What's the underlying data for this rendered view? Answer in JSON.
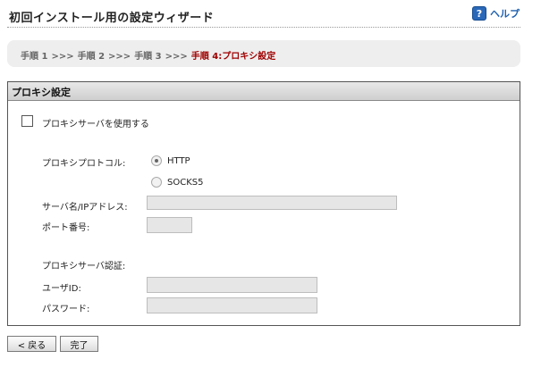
{
  "header": {
    "title": "初回インストール用の設定ウィザード",
    "help_label": "ヘルプ",
    "help_icon": "?"
  },
  "breadcrumb": {
    "steps": [
      "手順 1",
      "手順 2",
      "手順 3"
    ],
    "separator": ">>>",
    "current": "手順 4:プロキシ設定"
  },
  "panel": {
    "title": "プロキシ設定",
    "use_proxy_label": "プロキシサーバを使用する",
    "protocol_label": "プロキシプロトコル:",
    "protocol_options": [
      "HTTP",
      "SOCKS5"
    ],
    "protocol_selected": "HTTP",
    "server_label": "サーバ名/IPアドレス:",
    "server_value": "",
    "port_label": "ポート番号:",
    "port_value": "",
    "auth_label": "プロキシサーバ認証:",
    "userid_label": "ユーザID:",
    "userid_value": "",
    "password_label": "パスワード:",
    "password_value": ""
  },
  "footer": {
    "back_label": "< 戻る",
    "finish_label": "完了"
  }
}
